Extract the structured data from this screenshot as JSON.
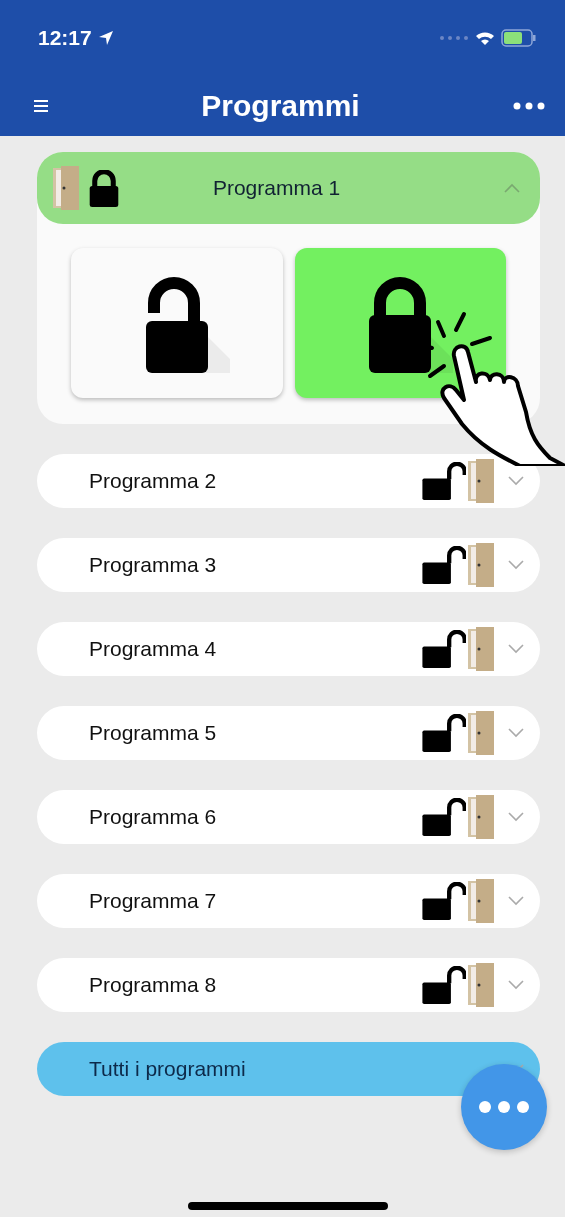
{
  "status_bar": {
    "time": "12:17"
  },
  "header": {
    "title": "Programmi"
  },
  "programs": [
    {
      "kind": "program",
      "label": "Programma 1",
      "expanded": true,
      "locked": true,
      "actions": [
        {
          "kind": "unlock",
          "selected": false
        },
        {
          "kind": "lock",
          "selected": true
        }
      ]
    },
    {
      "kind": "program",
      "label": "Programma 2",
      "expanded": false,
      "locked": false
    },
    {
      "kind": "program",
      "label": "Programma 3",
      "expanded": false,
      "locked": false
    },
    {
      "kind": "program",
      "label": "Programma 4",
      "expanded": false,
      "locked": false
    },
    {
      "kind": "program",
      "label": "Programma 5",
      "expanded": false,
      "locked": false
    },
    {
      "kind": "program",
      "label": "Programma 6",
      "expanded": false,
      "locked": false
    },
    {
      "kind": "program",
      "label": "Programma 7",
      "expanded": false,
      "locked": false
    },
    {
      "kind": "program",
      "label": "Programma 8",
      "expanded": false,
      "locked": false
    },
    {
      "kind": "all",
      "label": "Tutti i programmi",
      "expanded": false
    }
  ]
}
